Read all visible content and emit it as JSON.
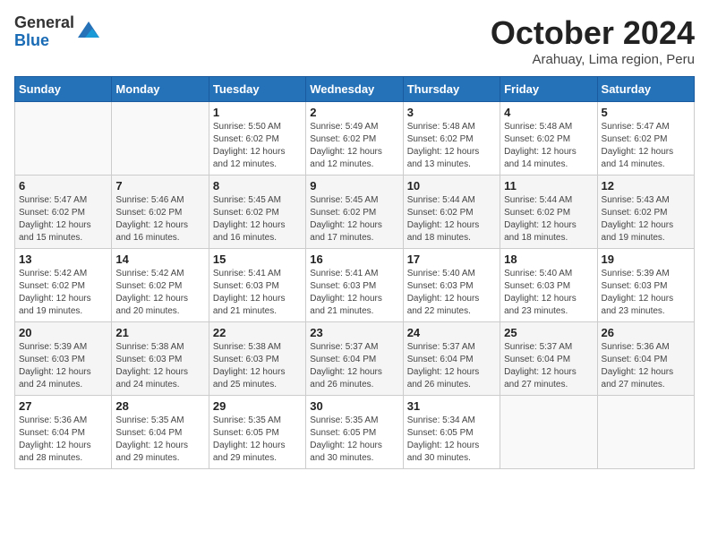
{
  "header": {
    "logo_general": "General",
    "logo_blue": "Blue",
    "title": "October 2024",
    "location": "Arahuay, Lima region, Peru"
  },
  "calendar": {
    "days_of_week": [
      "Sunday",
      "Monday",
      "Tuesday",
      "Wednesday",
      "Thursday",
      "Friday",
      "Saturday"
    ],
    "weeks": [
      [
        {
          "day": "",
          "info": ""
        },
        {
          "day": "",
          "info": ""
        },
        {
          "day": "1",
          "info": "Sunrise: 5:50 AM\nSunset: 6:02 PM\nDaylight: 12 hours and 12 minutes."
        },
        {
          "day": "2",
          "info": "Sunrise: 5:49 AM\nSunset: 6:02 PM\nDaylight: 12 hours and 12 minutes."
        },
        {
          "day": "3",
          "info": "Sunrise: 5:48 AM\nSunset: 6:02 PM\nDaylight: 12 hours and 13 minutes."
        },
        {
          "day": "4",
          "info": "Sunrise: 5:48 AM\nSunset: 6:02 PM\nDaylight: 12 hours and 14 minutes."
        },
        {
          "day": "5",
          "info": "Sunrise: 5:47 AM\nSunset: 6:02 PM\nDaylight: 12 hours and 14 minutes."
        }
      ],
      [
        {
          "day": "6",
          "info": "Sunrise: 5:47 AM\nSunset: 6:02 PM\nDaylight: 12 hours and 15 minutes."
        },
        {
          "day": "7",
          "info": "Sunrise: 5:46 AM\nSunset: 6:02 PM\nDaylight: 12 hours and 16 minutes."
        },
        {
          "day": "8",
          "info": "Sunrise: 5:45 AM\nSunset: 6:02 PM\nDaylight: 12 hours and 16 minutes."
        },
        {
          "day": "9",
          "info": "Sunrise: 5:45 AM\nSunset: 6:02 PM\nDaylight: 12 hours and 17 minutes."
        },
        {
          "day": "10",
          "info": "Sunrise: 5:44 AM\nSunset: 6:02 PM\nDaylight: 12 hours and 18 minutes."
        },
        {
          "day": "11",
          "info": "Sunrise: 5:44 AM\nSunset: 6:02 PM\nDaylight: 12 hours and 18 minutes."
        },
        {
          "day": "12",
          "info": "Sunrise: 5:43 AM\nSunset: 6:02 PM\nDaylight: 12 hours and 19 minutes."
        }
      ],
      [
        {
          "day": "13",
          "info": "Sunrise: 5:42 AM\nSunset: 6:02 PM\nDaylight: 12 hours and 19 minutes."
        },
        {
          "day": "14",
          "info": "Sunrise: 5:42 AM\nSunset: 6:02 PM\nDaylight: 12 hours and 20 minutes."
        },
        {
          "day": "15",
          "info": "Sunrise: 5:41 AM\nSunset: 6:03 PM\nDaylight: 12 hours and 21 minutes."
        },
        {
          "day": "16",
          "info": "Sunrise: 5:41 AM\nSunset: 6:03 PM\nDaylight: 12 hours and 21 minutes."
        },
        {
          "day": "17",
          "info": "Sunrise: 5:40 AM\nSunset: 6:03 PM\nDaylight: 12 hours and 22 minutes."
        },
        {
          "day": "18",
          "info": "Sunrise: 5:40 AM\nSunset: 6:03 PM\nDaylight: 12 hours and 23 minutes."
        },
        {
          "day": "19",
          "info": "Sunrise: 5:39 AM\nSunset: 6:03 PM\nDaylight: 12 hours and 23 minutes."
        }
      ],
      [
        {
          "day": "20",
          "info": "Sunrise: 5:39 AM\nSunset: 6:03 PM\nDaylight: 12 hours and 24 minutes."
        },
        {
          "day": "21",
          "info": "Sunrise: 5:38 AM\nSunset: 6:03 PM\nDaylight: 12 hours and 24 minutes."
        },
        {
          "day": "22",
          "info": "Sunrise: 5:38 AM\nSunset: 6:03 PM\nDaylight: 12 hours and 25 minutes."
        },
        {
          "day": "23",
          "info": "Sunrise: 5:37 AM\nSunset: 6:04 PM\nDaylight: 12 hours and 26 minutes."
        },
        {
          "day": "24",
          "info": "Sunrise: 5:37 AM\nSunset: 6:04 PM\nDaylight: 12 hours and 26 minutes."
        },
        {
          "day": "25",
          "info": "Sunrise: 5:37 AM\nSunset: 6:04 PM\nDaylight: 12 hours and 27 minutes."
        },
        {
          "day": "26",
          "info": "Sunrise: 5:36 AM\nSunset: 6:04 PM\nDaylight: 12 hours and 27 minutes."
        }
      ],
      [
        {
          "day": "27",
          "info": "Sunrise: 5:36 AM\nSunset: 6:04 PM\nDaylight: 12 hours and 28 minutes."
        },
        {
          "day": "28",
          "info": "Sunrise: 5:35 AM\nSunset: 6:04 PM\nDaylight: 12 hours and 29 minutes."
        },
        {
          "day": "29",
          "info": "Sunrise: 5:35 AM\nSunset: 6:05 PM\nDaylight: 12 hours and 29 minutes."
        },
        {
          "day": "30",
          "info": "Sunrise: 5:35 AM\nSunset: 6:05 PM\nDaylight: 12 hours and 30 minutes."
        },
        {
          "day": "31",
          "info": "Sunrise: 5:34 AM\nSunset: 6:05 PM\nDaylight: 12 hours and 30 minutes."
        },
        {
          "day": "",
          "info": ""
        },
        {
          "day": "",
          "info": ""
        }
      ]
    ]
  }
}
